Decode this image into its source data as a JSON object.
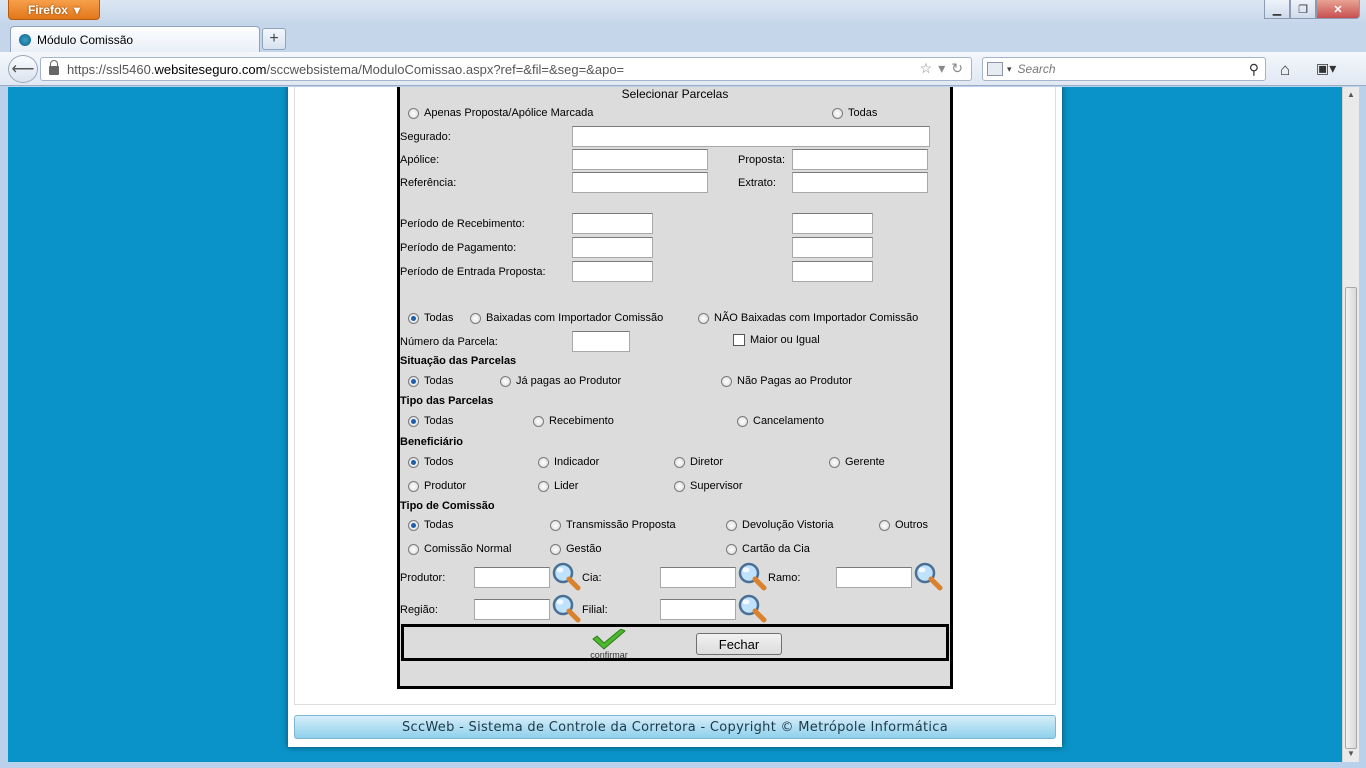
{
  "browser": {
    "app_button": "Firefox",
    "tab_title": "Módulo Comissão",
    "url_prefix": "https://ssl5460.",
    "url_domain": "websiteseguro.com",
    "url_path": "/sccwebsistema/ModuloComissao.aspx?ref=&fil=&seg=&apo=",
    "search_placeholder": "Search"
  },
  "form": {
    "title": "Selecionar Parcelas",
    "scope_options": [
      "Apenas Proposta/Apólice Marcada",
      "Todas"
    ],
    "labels": {
      "segurado": "Segurado:",
      "apolice": "Apólice:",
      "proposta": "Proposta:",
      "referencia": "Referência:",
      "extrato": "Extrato:",
      "periodo_recebimento": "Período de Recebimento:",
      "periodo_pagamento": "Período de Pagamento:",
      "periodo_entrada": "Período de Entrada Proposta:",
      "numero_parcela": "Número da Parcela:",
      "maior_igual": "Maior ou Igual",
      "produtor": "Produtor:",
      "cia": "Cia:",
      "ramo": "Ramo:",
      "regiao": "Região:",
      "filial": "Filial:"
    },
    "baixa_options": [
      "Todas",
      "Baixadas com Importador Comissão",
      "NÃO Baixadas com Importador Comissão"
    ],
    "situacao": {
      "heading": "Situação das Parcelas",
      "options": [
        "Todas",
        "Já pagas ao Produtor",
        "Não Pagas ao Produtor"
      ]
    },
    "tipo_parcelas": {
      "heading": "Tipo das Parcelas",
      "options": [
        "Todas",
        "Recebimento",
        "Cancelamento"
      ]
    },
    "beneficiario": {
      "heading": "Beneficiário",
      "options": [
        "Todos",
        "Indicador",
        "Diretor",
        "Gerente",
        "Produtor",
        "Lider",
        "Supervisor"
      ]
    },
    "tipo_comissao": {
      "heading": "Tipo de Comissão",
      "options": [
        "Todas",
        "Transmissão Proposta",
        "Devolução Vistoria",
        "Outros",
        "Comissão Normal",
        "Gestão",
        "Cartão da Cia"
      ]
    },
    "confirm_label": "confirmar",
    "close_label": "Fechar"
  },
  "footer": {
    "copyright": "SccWeb - Sistema de Controle da Corretora - Copyright © Metrópole Informática"
  },
  "colors": {
    "page_bg": "#0a93c8",
    "dialog_bg": "#dcdcdc",
    "radio_checked": "#1d5fab"
  }
}
